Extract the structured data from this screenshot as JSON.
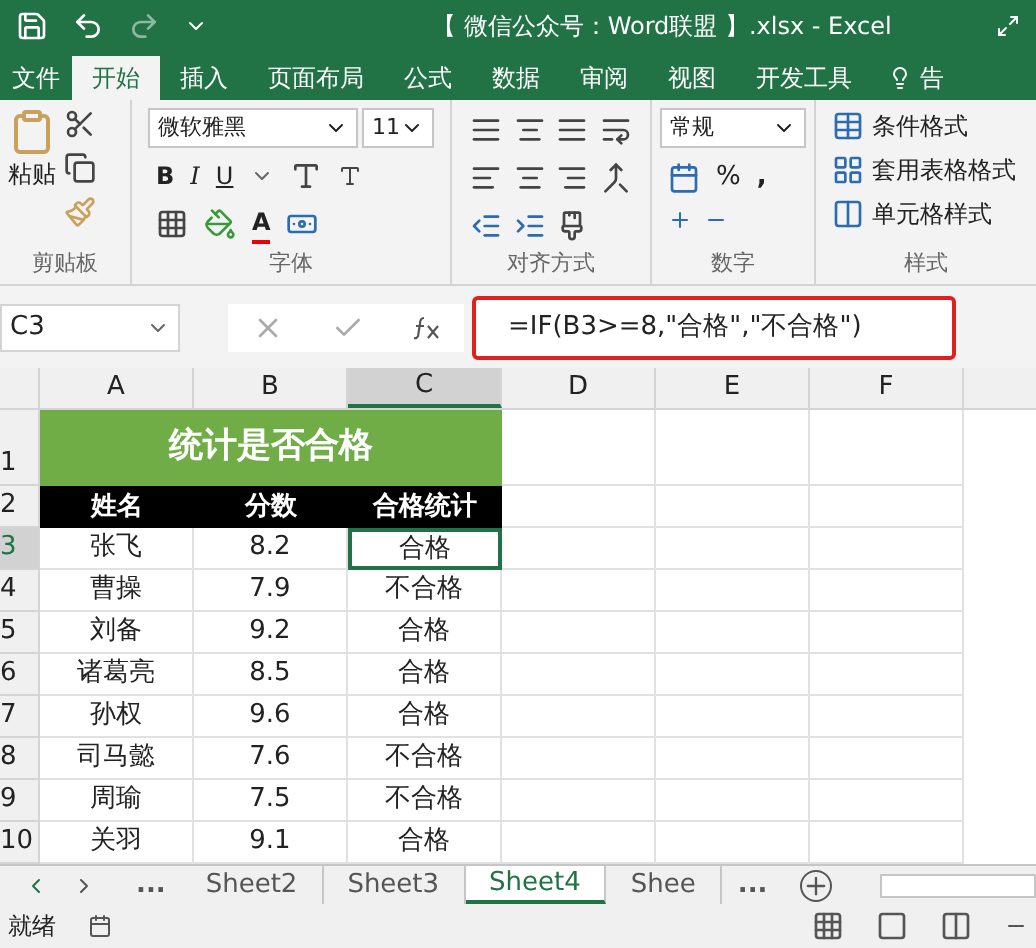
{
  "window": {
    "title": "【 微信公众号：Word联盟 】.xlsx - Excel"
  },
  "ribbon_tabs": [
    {
      "label": "文件",
      "selected": false,
      "kind": "file"
    },
    {
      "label": "开始",
      "selected": true,
      "kind": "tab"
    },
    {
      "label": "插入",
      "selected": false,
      "kind": "tab"
    },
    {
      "label": "页面布局",
      "selected": false,
      "kind": "tab"
    },
    {
      "label": "公式",
      "selected": false,
      "kind": "tab"
    },
    {
      "label": "数据",
      "selected": false,
      "kind": "tab"
    },
    {
      "label": "审阅",
      "selected": false,
      "kind": "tab"
    },
    {
      "label": "视图",
      "selected": false,
      "kind": "tab"
    },
    {
      "label": "开发工具",
      "selected": false,
      "kind": "tab"
    },
    {
      "label": "告",
      "selected": false,
      "kind": "tell"
    }
  ],
  "clipboard": {
    "paste": "粘贴",
    "label": "剪贴板"
  },
  "font": {
    "name": "微软雅黑",
    "size": "11",
    "bold": "B",
    "italic": "I",
    "underline": "U",
    "color_letter": "A",
    "label": "字体"
  },
  "alignment": {
    "label": "对齐方式"
  },
  "number": {
    "format": "常规",
    "percent": "%",
    "comma": ",",
    "label": "数字"
  },
  "styles": {
    "items": [
      "条件格式",
      "套用表格格式",
      "单元格样式"
    ],
    "label": "样式"
  },
  "name_box": "C3",
  "formula": "=IF(B3>=8,\"合格\",\"不合格\")",
  "columns": [
    {
      "label": "A",
      "selected": false
    },
    {
      "label": "B",
      "selected": false
    },
    {
      "label": "C",
      "selected": true
    },
    {
      "label": "D",
      "selected": false
    },
    {
      "label": "E",
      "selected": false
    },
    {
      "label": "F",
      "selected": false
    }
  ],
  "rows": [
    {
      "number": "1",
      "kind": "title",
      "selected": false,
      "cells": [
        "统计是否合格"
      ]
    },
    {
      "number": "2",
      "kind": "header",
      "selected": false,
      "cells": [
        "姓名",
        "分数",
        "合格统计"
      ]
    },
    {
      "number": "3",
      "kind": "data",
      "selected": true,
      "cells": [
        "张飞",
        "8.2",
        "合格"
      ]
    },
    {
      "number": "4",
      "kind": "data",
      "selected": false,
      "cells": [
        "曹操",
        "7.9",
        "不合格"
      ]
    },
    {
      "number": "5",
      "kind": "data",
      "selected": false,
      "cells": [
        "刘备",
        "9.2",
        "合格"
      ]
    },
    {
      "number": "6",
      "kind": "data",
      "selected": false,
      "cells": [
        "诸葛亮",
        "8.5",
        "合格"
      ]
    },
    {
      "number": "7",
      "kind": "data",
      "selected": false,
      "cells": [
        "孙权",
        "9.6",
        "合格"
      ]
    },
    {
      "number": "8",
      "kind": "data",
      "selected": false,
      "cells": [
        "司马懿",
        "7.6",
        "不合格"
      ]
    },
    {
      "number": "9",
      "kind": "data",
      "selected": false,
      "cells": [
        "周瑜",
        "7.5",
        "不合格"
      ]
    },
    {
      "number": "10",
      "kind": "data",
      "selected": false,
      "cells": [
        "关羽",
        "9.1",
        "合格"
      ]
    }
  ],
  "sheet_tabs": [
    {
      "label": "...",
      "selected": false,
      "kind": "more"
    },
    {
      "label": "Sheet2",
      "selected": false,
      "kind": "sheet"
    },
    {
      "label": "Sheet3",
      "selected": false,
      "kind": "sheet"
    },
    {
      "label": "Sheet4",
      "selected": true,
      "kind": "sheet"
    },
    {
      "label": "Shee",
      "selected": false,
      "kind": "sheet"
    },
    {
      "label": "...",
      "selected": false,
      "kind": "more"
    }
  ],
  "status_bar": {
    "text": "就绪"
  }
}
